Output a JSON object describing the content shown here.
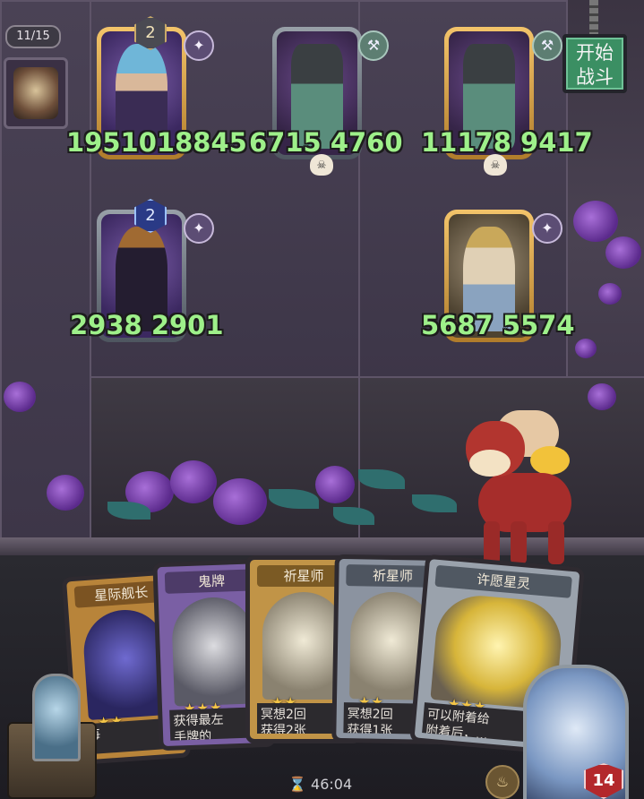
{
  "header": {
    "progress": "11/15",
    "start_button": "开始\n战斗"
  },
  "board": {
    "slots": [
      {
        "attack": "19510",
        "health": "18845",
        "level": "2"
      },
      {
        "attack": "6715",
        "health": "4760"
      },
      {
        "attack": "11178",
        "health": "9417"
      },
      {
        "attack": "2938",
        "health": "2901",
        "level": "2"
      },
      {
        "attack": "5687",
        "health": "5574"
      }
    ]
  },
  "hand": {
    "cards": [
      {
        "title": "星际舰长",
        "text": "每"
      },
      {
        "title": "鬼牌",
        "text": "获得最左\n手牌的"
      },
      {
        "title": "祈星师",
        "text": "冥想2回\n获得2张"
      },
      {
        "title": "祈星师",
        "text": "冥想2回\n获得1张"
      },
      {
        "title": "许愿星灵",
        "text": "可以附着给\n附着后，..."
      }
    ]
  },
  "footer": {
    "timer": "46:04",
    "hero_health": "14"
  }
}
